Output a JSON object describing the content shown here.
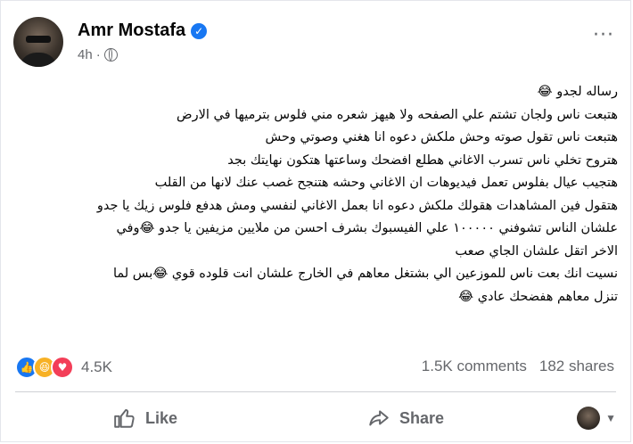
{
  "post": {
    "author": "Amr Mostafa",
    "time": "4h",
    "lines": [
      "رساله لجدو 😂",
      "هتبعت ناس ولجان تشتم علي الصفحه ولا هيهز شعره مني فلوس بترميها في الارض",
      "هتبعت ناس تقول صوته وحش ملكش دعوه انا هغني وصوتي وحش",
      "هتروح تخلي ناس تسرب الاغاني هطلع افضحك وساعتها هتكون نهايتك بجد",
      "هتجيب عيال بفلوس  تعمل فيديوهات ان الاغاني وحشه هتنجح غصب عنك لانها من القلب",
      "هتقول فين المشاهدات هقولك ملكش دعوه انا بعمل الاغاني لنفسي ومش هدفع فلوس زيك يا جدو",
      "علشان الناس تشوفني ١٠٠٠٠٠  علي الفيسبوك بشرف احسن من ملايين مزيفين يا جدو 😂وفي",
      "الاخر اتقل علشان الجاي صعب",
      "نسيت انك بعت ناس للموزعين الي بشتغل معاهم في الخارج علشان انت  قلوده قوي 😂بس لما",
      "تنزل معاهم هفضحك عادي 😂"
    ]
  },
  "reactions": {
    "icons": [
      "like-icon",
      "haha-icon",
      "love-icon"
    ],
    "count": "4.5K"
  },
  "stats": {
    "comments": "1.5K comments",
    "shares": "182 shares"
  },
  "actions": {
    "like_label": "Like",
    "share_label": "Share"
  },
  "colors": {
    "accent": "#1877f2",
    "muted": "#65676b",
    "love": "#f33e58",
    "haha": "#f7b125"
  }
}
